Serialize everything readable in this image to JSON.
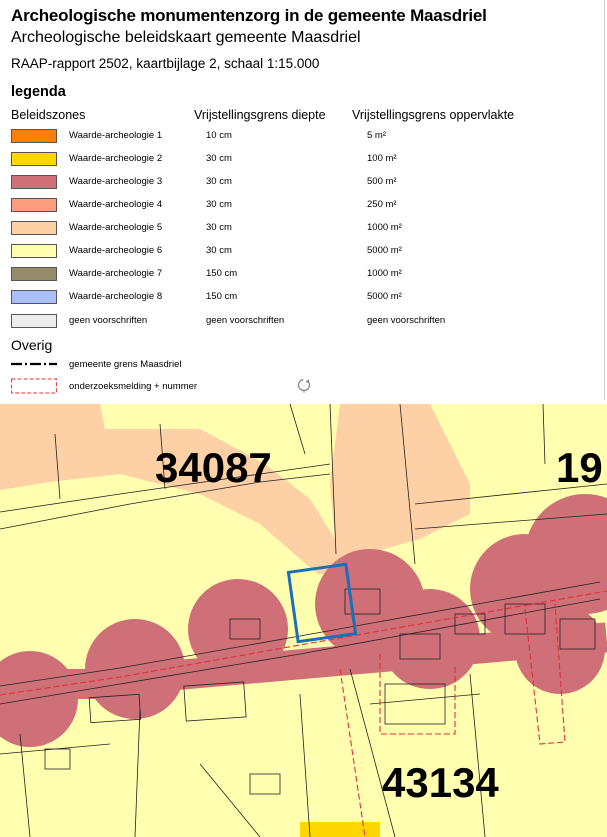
{
  "header": {
    "title": "Archeologische monumentenzorg in de gemeente Maasdriel",
    "subtitle": "Archeologische beleidskaart gemeente Maasdriel",
    "report": "RAAP-rapport 2502, kaartbijlage 2, schaal 1:15.000"
  },
  "legend": {
    "heading": "legenda",
    "columns": [
      "Beleidszones",
      "Vrijstellingsgrens diepte",
      "Vrijstellingsgrens oppervlakte"
    ],
    "zones": [
      {
        "name": "Waarde-archeologie 1",
        "depth": "10 cm",
        "area": "5 m²",
        "color": "#ff7f00"
      },
      {
        "name": "Waarde-archeologie 2",
        "depth": "30 cm",
        "area": "100 m²",
        "color": "#ffd700"
      },
      {
        "name": "Waarde-archeologie 3",
        "depth": "30 cm",
        "area": "500 m²",
        "color": "#cf6f78"
      },
      {
        "name": "Waarde-archeologie 4",
        "depth": "30 cm",
        "area": "250 m²",
        "color": "#fb9e7e"
      },
      {
        "name": "Waarde-archeologie 5",
        "depth": "30 cm",
        "area": "1000 m²",
        "color": "#fdd0a6"
      },
      {
        "name": "Waarde-archeologie 6",
        "depth": "30 cm",
        "area": "5000 m²",
        "color": "#ffffaf"
      },
      {
        "name": "Waarde-archeologie 7",
        "depth": "150 cm",
        "area": "1000 m²",
        "color": "#958d6e"
      },
      {
        "name": "Waarde-archeologie 8",
        "depth": "150 cm",
        "area": "5000 m²",
        "color": "#a9bffa"
      },
      {
        "name": "geen voorschriften",
        "depth": "geen voorschriften",
        "area": "geen voorschriften",
        "color": "#ececec"
      }
    ],
    "other_heading": "Overig",
    "other": [
      {
        "name": "gemeente grens Maasdriel"
      },
      {
        "name": "onderzoeksmelding + nummer"
      }
    ]
  },
  "map": {
    "labels": [
      "34087",
      "19",
      "43134"
    ],
    "colors": {
      "base": "#ffffaf",
      "zone5": "#fdd0a6",
      "zone3": "#cf6f78",
      "zone2": "#ffd700",
      "selection": "#1a6fb8",
      "melding": "#e0303a"
    }
  }
}
